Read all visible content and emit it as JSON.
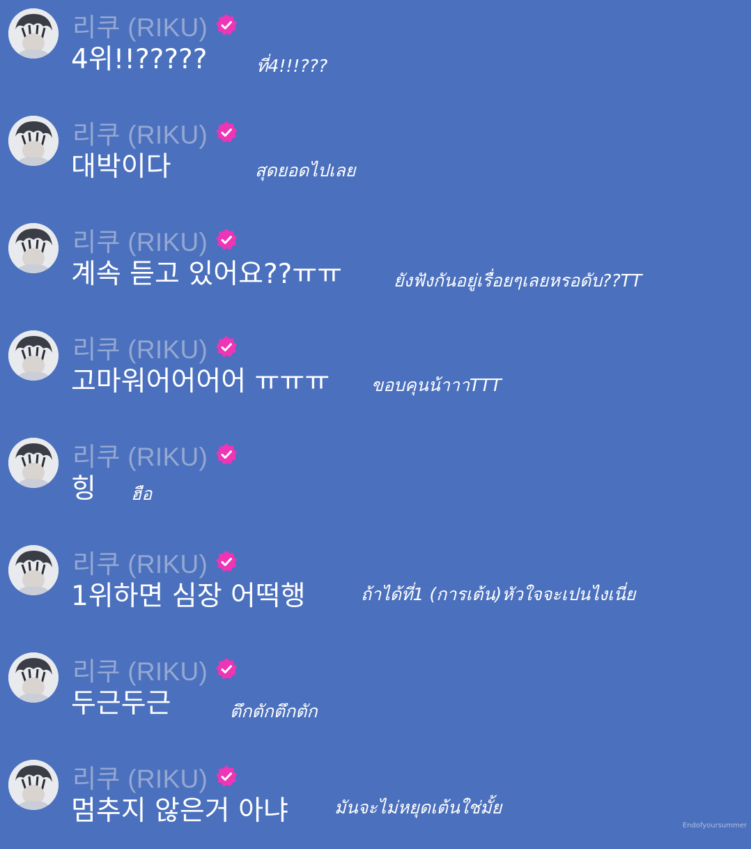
{
  "messages": [
    {
      "name": "리쿠 (RIKU)",
      "text": "4위!!?????",
      "translation": "ที่4!!!???"
    },
    {
      "name": "리쿠 (RIKU)",
      "text": "대박이다",
      "translation": "สุดยอดไปเลย"
    },
    {
      "name": "리쿠 (RIKU)",
      "text": "계속 듣고 있어요??ㅠㅠ",
      "translation": "ยังฟังกันอยู่เรื่อยๆเลยหรอดับ??TT"
    },
    {
      "name": "리쿠 (RIKU)",
      "text": "고마워어어어어 ㅠㅠㅠ",
      "translation": "ขอบคุนน้าาาTTT"
    },
    {
      "name": "리쿠 (RIKU)",
      "text": "힝",
      "translation": "ฮือ"
    },
    {
      "name": "리쿠 (RIKU)",
      "text": "1위하면 심장 어떡행",
      "translation": "ถ้าได้ที่1 (การเต้น)หัวใจจะเปนไงเนี่ย"
    },
    {
      "name": "리쿠 (RIKU)",
      "text": "두근두근",
      "translation": "ตึกตักตึกตัก"
    },
    {
      "name": "리쿠 (RIKU)",
      "text": "멈추지 않은거 아냐",
      "translation": "มันจะไม่หยุดเต้นใช่มั้ย"
    }
  ],
  "watermark": "Endofyoursummer",
  "colors": {
    "background": "#4b70bd",
    "name": "#95a8d3",
    "verified": "#ee35b7",
    "text": "#ffffff"
  },
  "icons": {
    "avatar": "avatar",
    "verified": "verified-icon"
  }
}
